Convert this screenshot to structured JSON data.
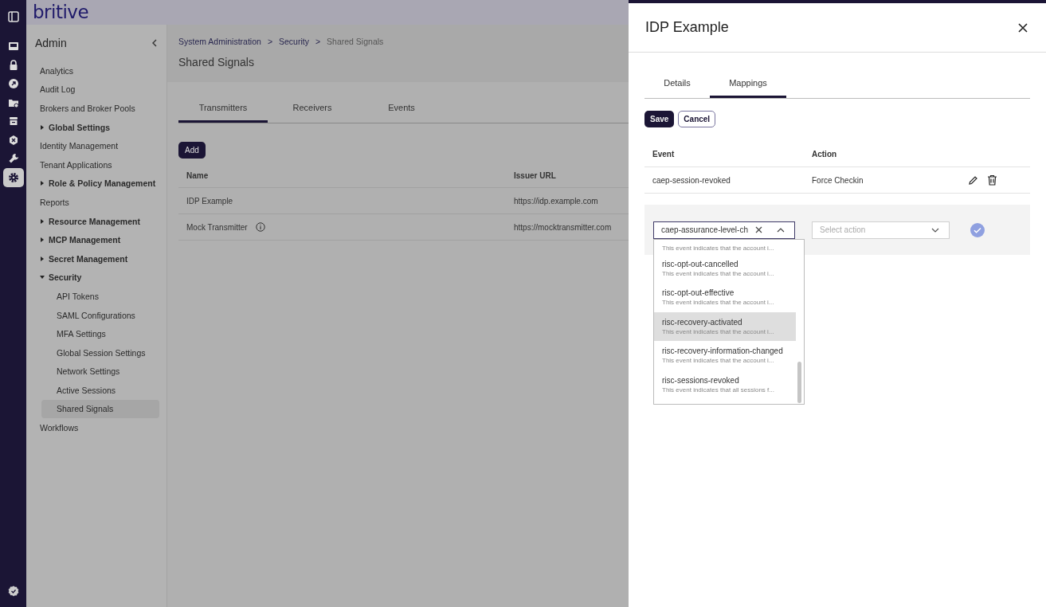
{
  "logo": "britive",
  "rail": [
    {
      "selected": false
    },
    {
      "selected": false
    },
    {
      "selected": false
    },
    {
      "selected": false
    },
    {
      "selected": false
    },
    {
      "selected": false
    },
    {
      "selected": false
    },
    {
      "selected": false
    },
    {
      "selected": true
    }
  ],
  "sidebar": {
    "title": "Admin",
    "items": [
      {
        "label": "Analytics",
        "kind": "link",
        "selected": false
      },
      {
        "label": "Audit Log",
        "kind": "link",
        "selected": false
      },
      {
        "label": "Brokers and Broker Pools",
        "kind": "link",
        "selected": false
      },
      {
        "label": "Global Settings",
        "kind": "group",
        "expanded": false
      },
      {
        "label": "Identity Management",
        "kind": "link",
        "selected": false
      },
      {
        "label": "Tenant Applications",
        "kind": "link",
        "selected": false
      },
      {
        "label": "Role & Policy Management",
        "kind": "group",
        "expanded": false
      },
      {
        "label": "Reports",
        "kind": "link",
        "selected": false
      },
      {
        "label": "Resource Management",
        "kind": "group",
        "expanded": false
      },
      {
        "label": "MCP Management",
        "kind": "group",
        "expanded": false
      },
      {
        "label": "Secret Management",
        "kind": "group",
        "expanded": false
      },
      {
        "label": "Security",
        "kind": "group",
        "expanded": true,
        "children": [
          {
            "label": "API Tokens",
            "selected": false
          },
          {
            "label": "SAML Configurations",
            "selected": false
          },
          {
            "label": "MFA Settings",
            "selected": false
          },
          {
            "label": "Global Session Settings",
            "selected": false
          },
          {
            "label": "Network Settings",
            "selected": false
          },
          {
            "label": "Active Sessions",
            "selected": false
          },
          {
            "label": "Shared Signals",
            "selected": true
          }
        ]
      },
      {
        "label": "Workflows",
        "kind": "link",
        "selected": false
      }
    ]
  },
  "breadcrumb": [
    {
      "label": "System Administration",
      "current": false
    },
    {
      "label": "Security",
      "current": false
    },
    {
      "label": "Shared Signals",
      "current": true
    }
  ],
  "breadcrumb_separator": ">",
  "page_title": "Shared Signals",
  "tabs": [
    {
      "label": "Transmitters",
      "selected": true
    },
    {
      "label": "Receivers",
      "selected": false
    },
    {
      "label": "Events",
      "selected": false
    }
  ],
  "add_button": "Add",
  "table": {
    "columns": [
      "Name",
      "Issuer URL"
    ],
    "rows": [
      {
        "name": "IDP Example",
        "info": false,
        "issuer_url": "https://idp.example.com"
      },
      {
        "name": "Mock Transmitter",
        "info": true,
        "issuer_url": "https://mocktransmitter.com"
      }
    ]
  },
  "drawer": {
    "title": "IDP Example",
    "tabs": [
      {
        "label": "Details",
        "selected": false
      },
      {
        "label": "Mappings",
        "selected": true
      }
    ],
    "save": "Save",
    "cancel": "Cancel",
    "columns": [
      "Event",
      "Action"
    ],
    "mappings": [
      {
        "event": "caep-session-revoked",
        "action": "Force Checkin"
      }
    ],
    "edit_row": {
      "event_value": "caep-assurance-level-ch",
      "action_placeholder": "Select action",
      "options": [
        {
          "description": "This event indicates that the account i...",
          "selected": false
        },
        {
          "title": "risc-opt-out-cancelled",
          "description": "This event indicates that the account i...",
          "selected": false
        },
        {
          "title": "risc-opt-out-effective",
          "description": "This event indicates that the account i...",
          "selected": false
        },
        {
          "title": "risc-recovery-activated",
          "description": "This event indicates that the account i...",
          "selected": true
        },
        {
          "title": "risc-recovery-information-changed",
          "description": "This event indicates that the account i...",
          "selected": false
        },
        {
          "title": "risc-sessions-revoked",
          "description": "This event indicates that all sessions f...",
          "selected": false
        }
      ]
    }
  }
}
